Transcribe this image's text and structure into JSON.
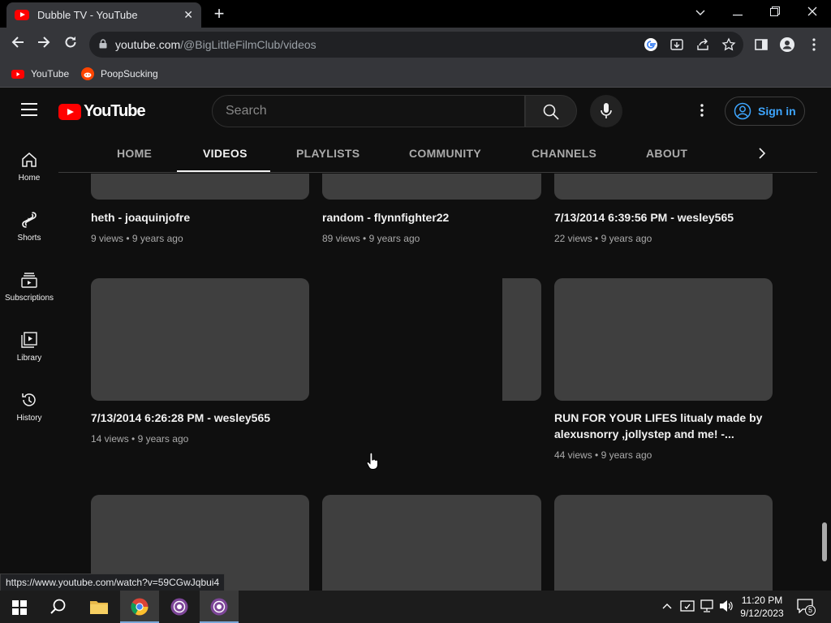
{
  "browser": {
    "tab_title": "Dubble TV - YouTube",
    "tab_close": "✕",
    "new_tab": "+",
    "url_host": "youtube.com",
    "url_path": "/@BigLittleFilmClub/videos",
    "bookmarks": [
      {
        "label": "YouTube"
      },
      {
        "label": "PoopSucking"
      }
    ],
    "status_url": "https://www.youtube.com/watch?v=59CGwJqbui4"
  },
  "yt": {
    "logo_text": "YouTube",
    "search_placeholder": "Search",
    "sign_in": "Sign in",
    "guide": [
      {
        "label": "Home"
      },
      {
        "label": "Shorts"
      },
      {
        "label": "Subscriptions"
      },
      {
        "label": "Library"
      },
      {
        "label": "History"
      }
    ],
    "tabs": [
      {
        "label": "HOME"
      },
      {
        "label": "VIDEOS"
      },
      {
        "label": "PLAYLISTS"
      },
      {
        "label": "COMMUNITY"
      },
      {
        "label": "CHANNELS"
      },
      {
        "label": "ABOUT"
      }
    ],
    "active_tab": "VIDEOS"
  },
  "videos": [
    {
      "title": "heth - joaquinjofre",
      "views": "9 views",
      "age": "9 years ago"
    },
    {
      "title": "random - flynnfighter22",
      "views": "89 views",
      "age": "9 years ago"
    },
    {
      "title": "7/13/2014 6:39:56 PM - wesley565",
      "views": "22 views",
      "age": "9 years ago"
    },
    {
      "title": "7/13/2014 6:26:28 PM - wesley565",
      "views": "14 views",
      "age": "9 years ago"
    },
    {
      "title": "RUN FOR YOUR LIFES litualy made by alexusnorry ,jollystep and me! -...",
      "views": "44 views",
      "age": "9 years ago"
    }
  ],
  "meta_separator": "•",
  "taskbar": {
    "time": "11:20 PM",
    "date": "9/12/2023",
    "notification_count": "5"
  }
}
